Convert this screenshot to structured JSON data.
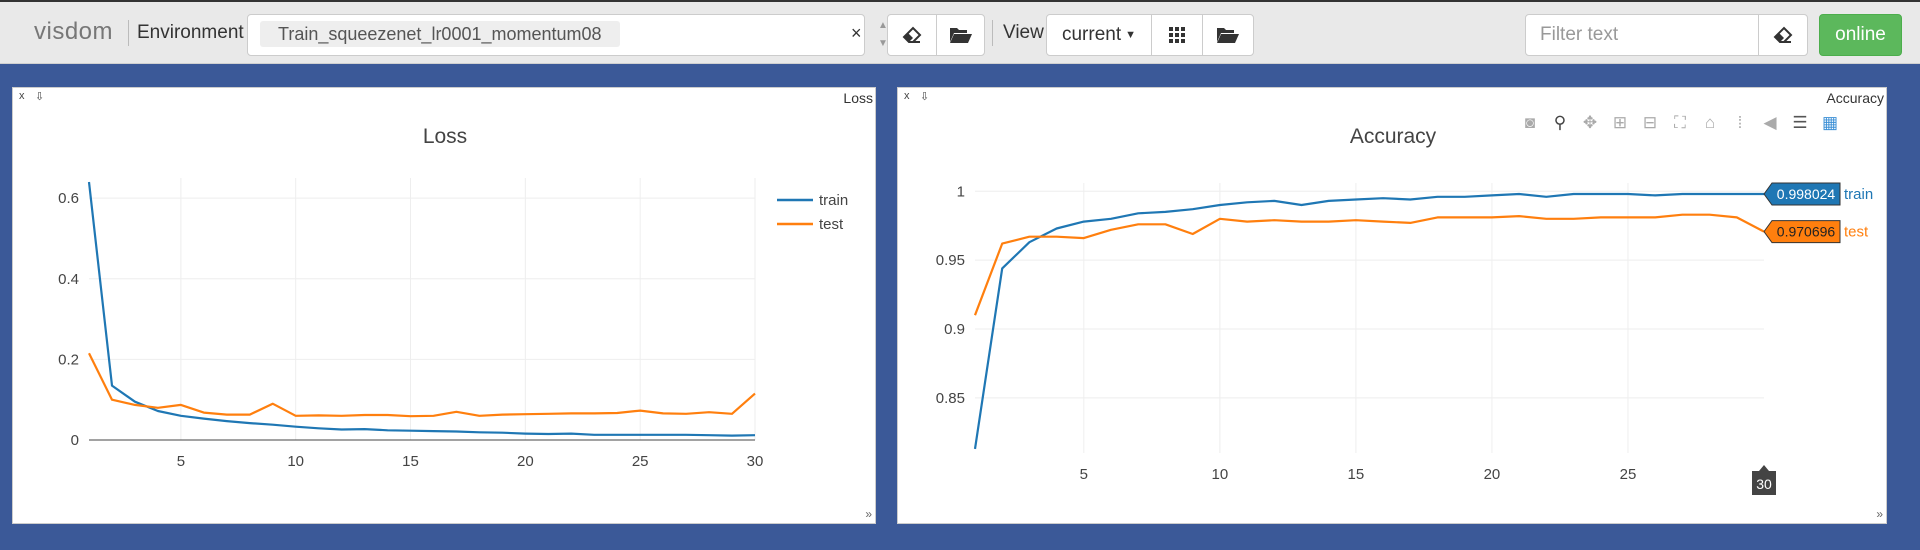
{
  "navbar": {
    "brand": "visdom",
    "environment_label": "Environment",
    "environment_value": "Train_squeezenet_lr0001_momentum08",
    "clear_symbol": "×",
    "view_label": "View",
    "view_value": "current",
    "filter_placeholder": "Filter text",
    "status_label": "online",
    "status_color": "#5cb85c"
  },
  "panes": [
    {
      "window_title": "Loss",
      "close_symbol": "x",
      "chart": {
        "type": "line",
        "title": "Loss",
        "xlim": [
          1,
          30
        ],
        "ylim": [
          0,
          0.65
        ],
        "x_ticks": [
          5,
          10,
          15,
          20,
          25,
          30
        ],
        "y_ticks": [
          0,
          0.2,
          0.4,
          0.6
        ],
        "y_tick_labels": [
          "0",
          "0.2",
          "0.4",
          "0.6"
        ],
        "legend": "top-right",
        "grid": true
      }
    },
    {
      "window_title": "Accuracy",
      "close_symbol": "x",
      "chart": {
        "type": "line",
        "title": "Accuracy",
        "xlim": [
          1,
          30
        ],
        "ylim": [
          0.81,
          1.006
        ],
        "x_ticks": [
          5,
          10,
          15,
          20,
          25
        ],
        "y_ticks": [
          0.85,
          0.9,
          0.95,
          1
        ],
        "y_tick_labels": [
          "0.85",
          "0.9",
          "0.95",
          "1"
        ],
        "hover": {
          "x_label": "30",
          "labels": [
            {
              "series": "train",
              "value": "0.998024"
            },
            {
              "series": "test",
              "value": "0.970696"
            }
          ]
        },
        "grid": true
      }
    }
  ],
  "chart_data": [
    {
      "type": "line",
      "title": "Loss",
      "xlabel": "",
      "ylabel": "",
      "xlim": [
        1,
        30
      ],
      "ylim": [
        0,
        0.65
      ],
      "x": [
        1,
        2,
        3,
        4,
        5,
        6,
        7,
        8,
        9,
        10,
        11,
        12,
        13,
        14,
        15,
        16,
        17,
        18,
        19,
        20,
        21,
        22,
        23,
        24,
        25,
        26,
        27,
        28,
        29,
        30
      ],
      "series": [
        {
          "name": "train",
          "color": "#1f77b4",
          "values": [
            0.64,
            0.135,
            0.095,
            0.072,
            0.06,
            0.053,
            0.047,
            0.042,
            0.038,
            0.033,
            0.029,
            0.026,
            0.027,
            0.024,
            0.023,
            0.022,
            0.021,
            0.019,
            0.018,
            0.016,
            0.015,
            0.016,
            0.013,
            0.013,
            0.013,
            0.013,
            0.013,
            0.012,
            0.011,
            0.012
          ]
        },
        {
          "name": "test",
          "color": "#ff7f0e",
          "values": [
            0.215,
            0.1,
            0.087,
            0.08,
            0.087,
            0.068,
            0.063,
            0.063,
            0.09,
            0.06,
            0.061,
            0.06,
            0.062,
            0.062,
            0.059,
            0.06,
            0.07,
            0.06,
            0.063,
            0.064,
            0.065,
            0.066,
            0.066,
            0.067,
            0.073,
            0.066,
            0.065,
            0.069,
            0.065,
            0.115
          ]
        }
      ],
      "legend": "top-right",
      "grid": true
    },
    {
      "type": "line",
      "title": "Accuracy",
      "xlabel": "",
      "ylabel": "",
      "xlim": [
        1,
        30
      ],
      "ylim": [
        0.81,
        1.006
      ],
      "x": [
        1,
        2,
        3,
        4,
        5,
        6,
        7,
        8,
        9,
        10,
        11,
        12,
        13,
        14,
        15,
        16,
        17,
        18,
        19,
        20,
        21,
        22,
        23,
        24,
        25,
        26,
        27,
        28,
        29,
        30
      ],
      "series": [
        {
          "name": "train",
          "color": "#1f77b4",
          "values": [
            0.813,
            0.944,
            0.963,
            0.973,
            0.978,
            0.98,
            0.984,
            0.985,
            0.987,
            0.99,
            0.992,
            0.993,
            0.99,
            0.993,
            0.994,
            0.995,
            0.994,
            0.996,
            0.996,
            0.997,
            0.998,
            0.996,
            0.998,
            0.998,
            0.998,
            0.997,
            0.998,
            0.998,
            0.998,
            0.998024
          ]
        },
        {
          "name": "test",
          "color": "#ff7f0e",
          "values": [
            0.91,
            0.962,
            0.967,
            0.967,
            0.966,
            0.972,
            0.976,
            0.976,
            0.969,
            0.98,
            0.978,
            0.979,
            0.978,
            0.978,
            0.979,
            0.978,
            0.977,
            0.981,
            0.981,
            0.981,
            0.982,
            0.98,
            0.98,
            0.981,
            0.981,
            0.981,
            0.983,
            0.983,
            0.981,
            0.970696
          ]
        }
      ],
      "legend": "hover-labels",
      "grid": true
    }
  ]
}
